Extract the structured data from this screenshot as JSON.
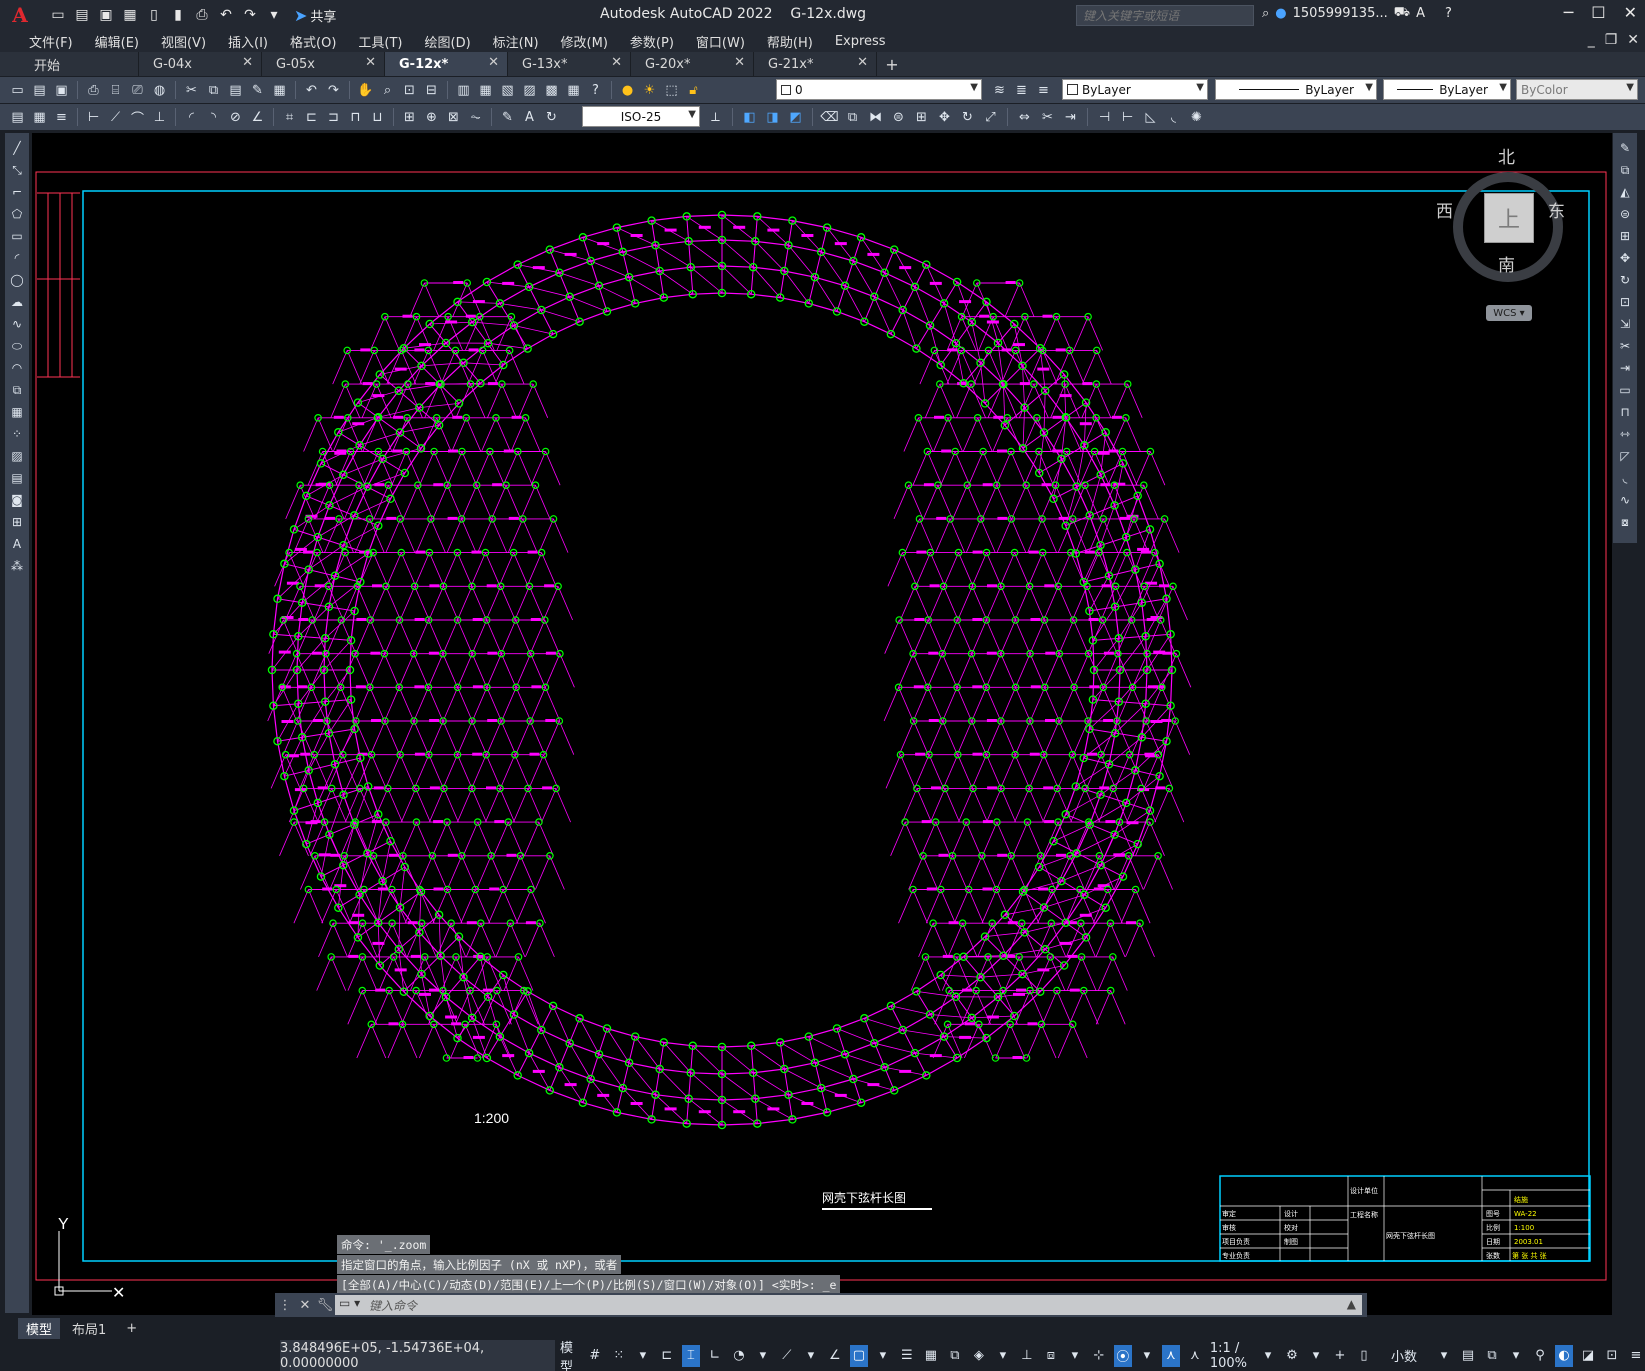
{
  "app": {
    "title": "Autodesk AutoCAD 2022    G-12x.dwg",
    "logo": "A",
    "share_label": "共享",
    "search_placeholder": "键入关键字或短语",
    "user": "1505999135...",
    "help": "?"
  },
  "menu": [
    "文件(F)",
    "编辑(E)",
    "视图(V)",
    "插入(I)",
    "格式(O)",
    "工具(T)",
    "绘图(D)",
    "标注(N)",
    "修改(M)",
    "参数(P)",
    "窗口(W)",
    "帮助(H)",
    "Express"
  ],
  "tabs": [
    {
      "label": "开始",
      "closable": false,
      "active": false
    },
    {
      "label": "G-04x",
      "closable": true,
      "active": false
    },
    {
      "label": "G-05x",
      "closable": true,
      "active": false
    },
    {
      "label": "G-12x*",
      "closable": true,
      "active": true
    },
    {
      "label": "G-13x*",
      "closable": true,
      "active": false
    },
    {
      "label": "G-20x*",
      "closable": true,
      "active": false
    },
    {
      "label": "G-21x*",
      "closable": true,
      "active": false
    }
  ],
  "toolbar": {
    "layer_value": "0",
    "color_value": "ByLayer",
    "linetype_value": "ByLayer",
    "lineweight_value": "ByLayer",
    "plotstyle_value": "ByColor",
    "dimstyle_value": "ISO-25"
  },
  "viewcube": {
    "north": "北",
    "south": "南",
    "east": "东",
    "west": "西",
    "top_face": "上",
    "wcs": "WCS"
  },
  "drawing": {
    "scale_label": "1:200",
    "figure_title": "网壳下弦杆长图",
    "accent_colors": {
      "mesh": "#ff00ff",
      "nodes": "#00ff00",
      "frame": "#00d0ff",
      "border": "#ff3355"
    },
    "title_block": {
      "design_unit": "设计单位",
      "project": "工程名称",
      "drawing_name": "网壳下弦杆长图",
      "labels": [
        "审定",
        "审核",
        "项目负责",
        "专业负责",
        "设计",
        "校对",
        "制图",
        "图号",
        "比例",
        "日期",
        "张数"
      ],
      "values": [
        "结施",
        "WA-22",
        "1:100",
        "2003.01",
        "第 张 共 张"
      ]
    }
  },
  "command": {
    "history": [
      "命令: '_.zoom",
      "指定窗口的角点，输入比例因子 (nX 或 nXP)，或者",
      "[全部(A)/中心(C)/动态(D)/范围(E)/上一个(P)/比例(S)/窗口(W)/对象(O)] <实时>: _e"
    ],
    "input_placeholder": "键入命令"
  },
  "layouts": [
    "模型",
    "布局1"
  ],
  "status": {
    "coordinates": "3.848496E+05, -1.54736E+04, 0.00000000",
    "space": "模型",
    "annotation_scale": "1:1 / 100%",
    "units": "小数"
  }
}
